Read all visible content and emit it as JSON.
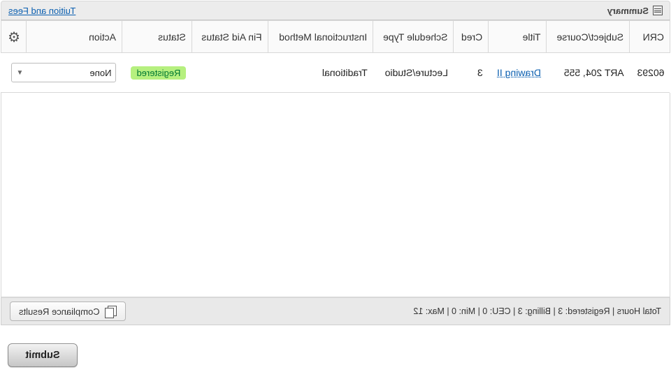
{
  "header": {
    "title": "Summary",
    "tuition_link": "Tuition and Fees"
  },
  "table": {
    "headers": {
      "crn": "CRN",
      "subject": "Subject/Course",
      "title": "Title",
      "cred": "Cred",
      "schedule_type": "Schedule Type",
      "instructional_method": "Instructional Method",
      "fin_aid_status": "Fin Aid Status",
      "status": "Status",
      "action": "Action"
    },
    "rows": [
      {
        "crn": "60293",
        "subject": "ART 204, 555",
        "title": "Drawing II",
        "cred": "3",
        "schedule_type": "Lecture/Studio",
        "instructional_method": "Traditional",
        "fin_aid_status": "",
        "status": "Registered",
        "action": "None"
      }
    ]
  },
  "footer": {
    "totals_full": "Total Hours | Registered: 3 | Billing: 3 | CEU: 0 | Min: 0 | Max: 12",
    "compliance_label": "Compliance Results"
  },
  "submit_label": "Submit"
}
